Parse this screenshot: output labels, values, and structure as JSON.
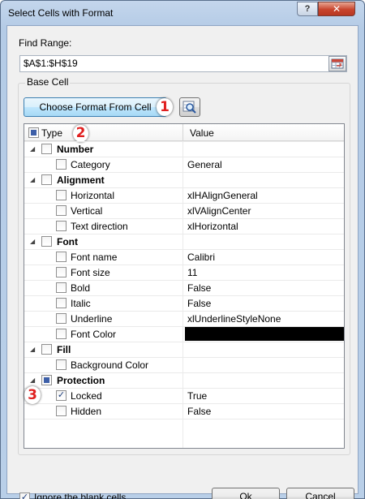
{
  "window": {
    "title": "Select Cells with Format"
  },
  "caption_buttons": {
    "help": "?",
    "close": "✕"
  },
  "find_range": {
    "label": "Find Range:",
    "value": "$A$1:$H$19"
  },
  "base_cell": {
    "label": "Base Cell",
    "choose_button": "Choose Format From Cell"
  },
  "tree": {
    "col_type": "Type",
    "col_value": "Value",
    "groups": [
      {
        "label": "Number",
        "state": "unchecked",
        "items": [
          {
            "label": "Category",
            "value": "General",
            "checked": false
          }
        ]
      },
      {
        "label": "Alignment",
        "state": "unchecked",
        "items": [
          {
            "label": "Horizontal",
            "value": "xlHAlignGeneral",
            "checked": false
          },
          {
            "label": "Vertical",
            "value": "xlVAlignCenter",
            "checked": false
          },
          {
            "label": "Text direction",
            "value": "xlHorizontal",
            "checked": false
          }
        ]
      },
      {
        "label": "Font",
        "state": "unchecked",
        "items": [
          {
            "label": "Font name",
            "value": "Calibri",
            "checked": false
          },
          {
            "label": "Font size",
            "value": "11",
            "checked": false
          },
          {
            "label": "Bold",
            "value": "False",
            "checked": false
          },
          {
            "label": "Italic",
            "value": "False",
            "checked": false
          },
          {
            "label": "Underline",
            "value": "xlUnderlineStyleNone",
            "checked": false
          },
          {
            "label": "Font Color",
            "value": "",
            "checked": false,
            "color_swatch": "#000000"
          }
        ]
      },
      {
        "label": "Fill",
        "state": "unchecked",
        "items": [
          {
            "label": "Background Color",
            "value": "",
            "checked": false
          }
        ]
      },
      {
        "label": "Protection",
        "state": "partial",
        "items": [
          {
            "label": "Locked",
            "value": "True",
            "checked": true
          },
          {
            "label": "Hidden",
            "value": "False",
            "checked": false
          }
        ]
      }
    ]
  },
  "callouts": {
    "one": "1",
    "two": "2",
    "three": "3"
  },
  "footer": {
    "ignore_blank_label": "Ignore the blank cells",
    "ignore_blank_checked": true,
    "ok": "Ok",
    "cancel": "Cancel"
  },
  "colors": {
    "callout_text": "#e02020",
    "partial_fill": "#3d5fa8",
    "title_bar": "#b9cfe8",
    "close_button": "#c8442d"
  }
}
